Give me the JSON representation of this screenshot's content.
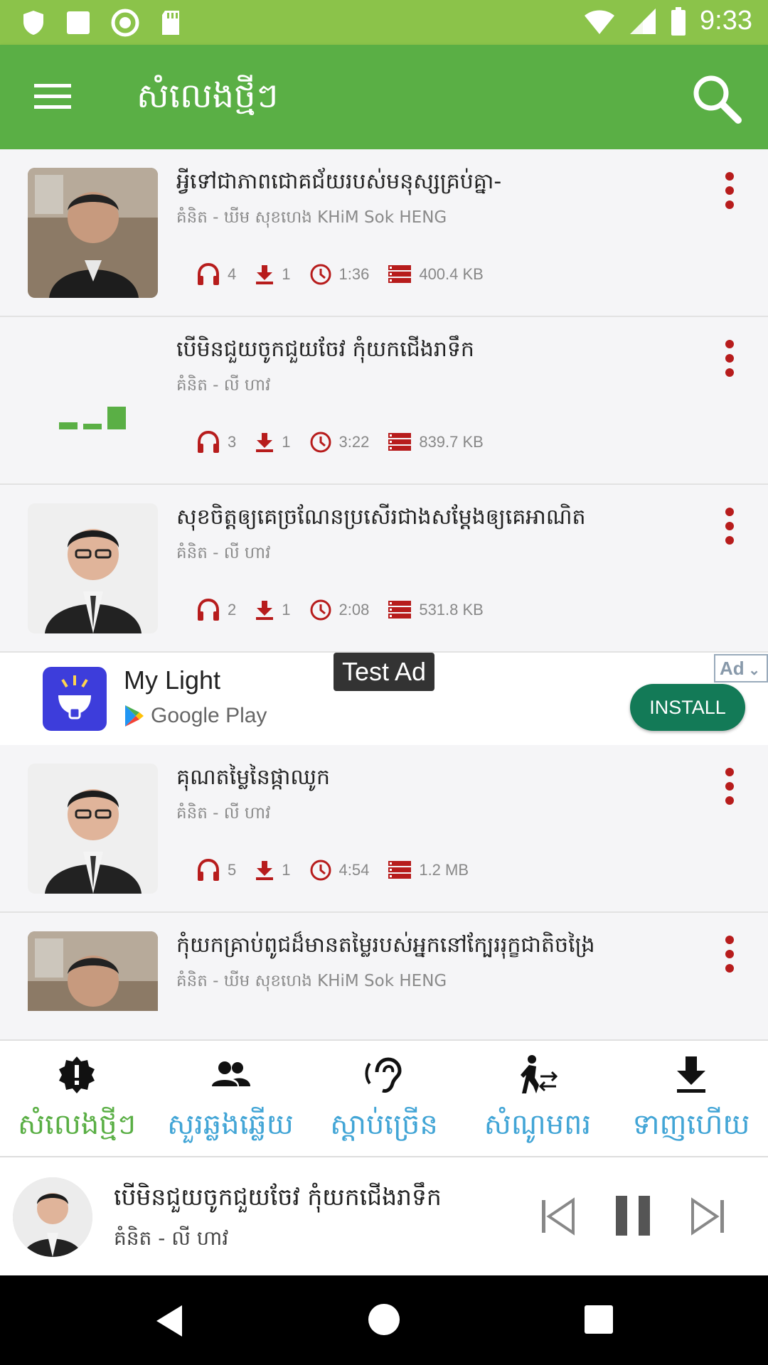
{
  "status_bar": {
    "time": "9:33"
  },
  "app_bar": {
    "title": "សំលេងថ្មីៗ"
  },
  "items": [
    {
      "title": "អ្វីទៅជាភាពជោគជ័យរបស់មនុស្សគ្រប់គ្នា-",
      "subtitle": "គំនិត - ឃីម សុខហេង KHiM Sok HENG",
      "listens": "4",
      "downloads": "1",
      "duration": "1:36",
      "size": "400.4 KB"
    },
    {
      "title": "បើមិនជួយចូកជួយចែវ  កុំយកជើងរាទឹក",
      "subtitle": "គំនិត - លី ហាវ",
      "listens": "3",
      "downloads": "1",
      "duration": "3:22",
      "size": "839.7 KB"
    },
    {
      "title": "សុខចិត្តឲ្យគេច្រណែនប្រសើរជាងសម្ដែងឲ្យគេអាណិត",
      "subtitle": "គំនិត - លី ហាវ",
      "listens": "2",
      "downloads": "1",
      "duration": "2:08",
      "size": "531.8 KB"
    },
    {
      "title": "គុណតម្លៃនៃផ្កាឈូក",
      "subtitle": "គំនិត - លី ហាវ",
      "listens": "5",
      "downloads": "1",
      "duration": "4:54",
      "size": "1.2 MB"
    },
    {
      "title": "កុំយកគ្រាប់ពូជដ៏មានតម្លៃរបស់អ្នកនៅក្បែររុក្ខជាតិចង្រៃ",
      "subtitle": "គំនិត - ឃីម សុខហេង KHiM Sok HENG"
    }
  ],
  "ad": {
    "app_name": "My Light",
    "store": "Google Play",
    "test_label": "Test Ad",
    "badge": "Ad",
    "install": "INSTALL"
  },
  "bottom_nav": [
    {
      "label": "សំលេងថ្មីៗ",
      "icon": "new-badge-icon"
    },
    {
      "label": "សួរឆ្លងឆ្លើយ",
      "icon": "people-icon"
    },
    {
      "label": "ស្ដាប់ច្រើន",
      "icon": "ear-icon"
    },
    {
      "label": "សំណូមពរ",
      "icon": "request-icon"
    },
    {
      "label": "ទាញហើយ",
      "icon": "download-icon"
    }
  ],
  "player": {
    "title": "បើមិនជួយចូកជួយចែវ  កុំយកជើងរាទឹក",
    "subtitle": "គំនិត - លី ហាវ"
  },
  "colors": {
    "status_bar": "#8bc34a",
    "app_bar": "#5aaf45",
    "nav_active": "#5aaf45",
    "nav_inactive": "#42a5d6",
    "stat_icon": "#b71c1c",
    "install": "#137a57"
  }
}
